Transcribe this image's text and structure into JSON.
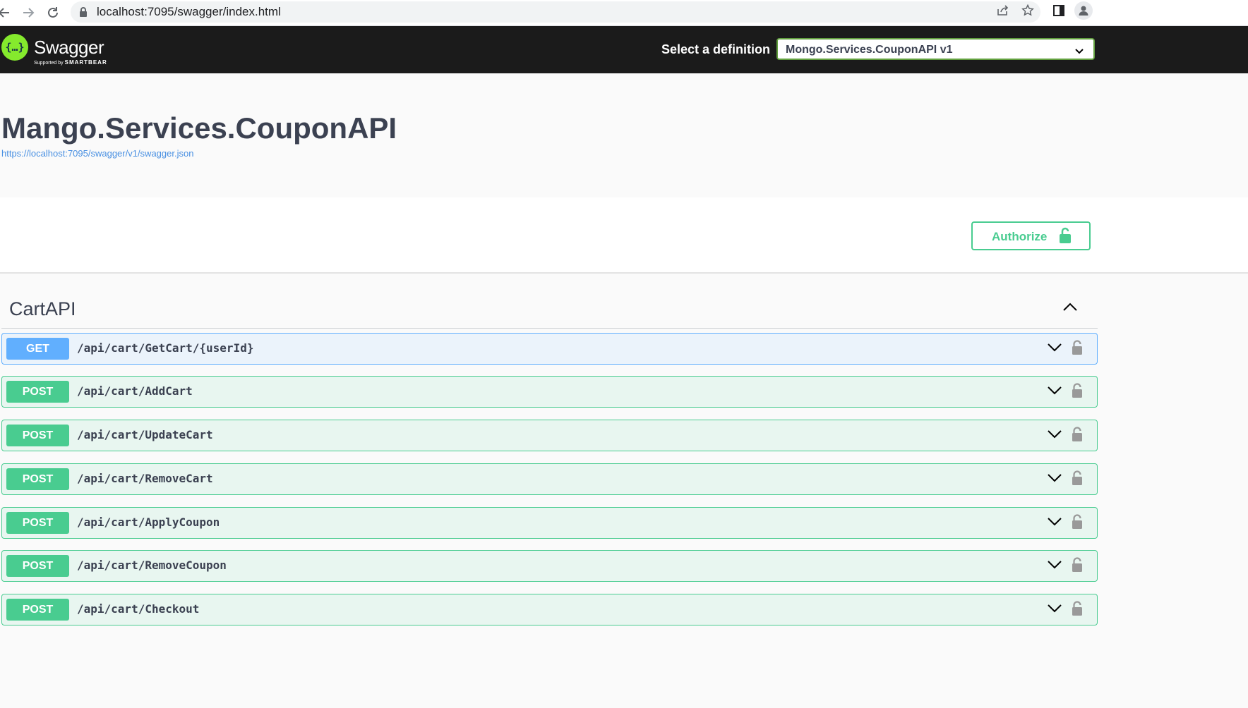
{
  "browser": {
    "url": "localhost:7095/swagger/index.html"
  },
  "topbar": {
    "logo_text": "Swagger",
    "logo_sub_prefix": "Supported by",
    "logo_sub_brand": "SMARTBEAR",
    "definition_label": "Select a definition",
    "definition_value": "Mongo.Services.CouponAPI v1"
  },
  "info": {
    "title": "Mango.Services.CouponAPI",
    "spec_url": "https://localhost:7095/swagger/v1/swagger.json"
  },
  "scheme": {
    "authorize_label": "Authorize"
  },
  "tag": {
    "name": "CartAPI"
  },
  "operations": [
    {
      "method": "GET",
      "path": "/api/cart/GetCart/{userId}"
    },
    {
      "method": "POST",
      "path": "/api/cart/AddCart"
    },
    {
      "method": "POST",
      "path": "/api/cart/UpdateCart"
    },
    {
      "method": "POST",
      "path": "/api/cart/RemoveCart"
    },
    {
      "method": "POST",
      "path": "/api/cart/ApplyCoupon"
    },
    {
      "method": "POST",
      "path": "/api/cart/RemoveCoupon"
    },
    {
      "method": "POST",
      "path": "/api/cart/Checkout"
    }
  ],
  "colors": {
    "get": "#61affe",
    "post": "#49cc90",
    "swagger_green": "#85ea2d",
    "topbar": "#1b1b1b"
  }
}
